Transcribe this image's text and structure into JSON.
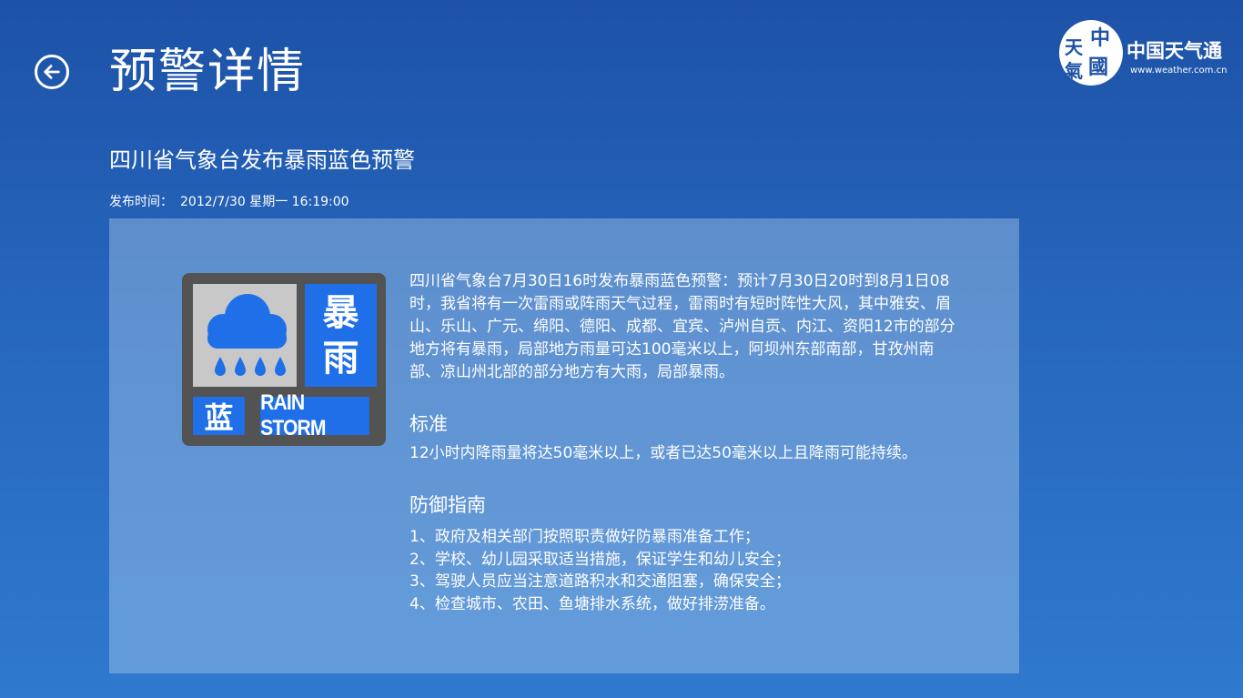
{
  "header": {
    "title": "预警详情",
    "back_label": "back"
  },
  "logo": {
    "badge_chars": [
      "中",
      "國",
      "天",
      "氣"
    ],
    "name": "中国天气通",
    "url": "www.weather.com.cn"
  },
  "alert": {
    "headline": "四川省气象台发布暴雨蓝色预警",
    "publish_label": "发布时间：",
    "publish_time": "2012/7/30 星期一 16:19:00",
    "badge": {
      "kind_line1": "暴",
      "kind_line2": "雨",
      "level": "蓝",
      "english": "RAIN STORM",
      "color": "#1e6fe8"
    },
    "description": "四川省气象台7月30日16时发布暴雨蓝色预警：预计7月30日20时到8月1日08时，我省将有一次雷雨或阵雨天气过程，雷雨时有短时阵性大风，其中雅安、眉山、乐山、广元、绵阳、德阳、成都、宜宾、泸州自贡、内江、资阳12市的部分地方将有暴雨，局部地方雨量可达100毫米以上，阿坝州东部南部，甘孜州南部、凉山州北部的部分地方有大雨，局部暴雨。",
    "standard_heading": "标准",
    "standard_text": "12小时内降雨量将达50毫米以上，或者已达50毫米以上且降雨可能持续。",
    "guide_heading": "防御指南",
    "guide_items": [
      "1、政府及相关部门按照职责做好防暴雨准备工作；",
      "2、学校、幼儿园采取适当措施，保证学生和幼儿安全；",
      "3、驾驶人员应当注意道路积水和交通阻塞，确保安全；",
      "4、检查城市、农田、鱼塘排水系统，做好排涝准备。"
    ]
  }
}
